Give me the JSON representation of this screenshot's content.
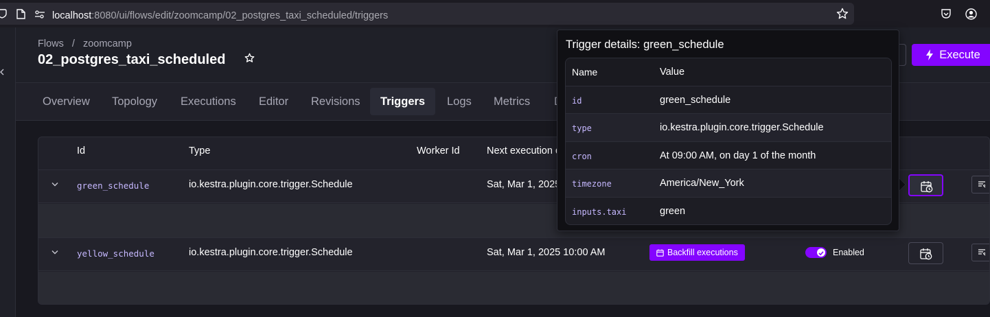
{
  "browser": {
    "url_host": "localhost",
    "url_rest": ":8080/ui/flows/edit/zoomcamp/02_postgres_taxi_scheduled/triggers"
  },
  "header": {
    "breadcrumb": [
      "Flows",
      "/",
      "zoomcamp"
    ],
    "title": "02_postgres_taxi_scheduled",
    "execute_label": "Execute"
  },
  "tabs": [
    {
      "label": "Overview"
    },
    {
      "label": "Topology"
    },
    {
      "label": "Executions"
    },
    {
      "label": "Editor"
    },
    {
      "label": "Revisions"
    },
    {
      "label": "Triggers",
      "active": true
    },
    {
      "label": "Logs"
    },
    {
      "label": "Metrics"
    },
    {
      "label": "D"
    }
  ],
  "table": {
    "headers": {
      "id": "Id",
      "type": "Type",
      "worker": "Worker Id",
      "next": "Next execution d"
    },
    "rows": [
      {
        "id": "green_schedule",
        "type": "io.kestra.plugin.core.trigger.Schedule",
        "next": "Sat, Mar 1, 2025"
      },
      {
        "id": "yellow_schedule",
        "type": "io.kestra.plugin.core.trigger.Schedule",
        "next": "Sat, Mar 1, 2025 10:00 AM",
        "backfill": "Backfill executions",
        "status": "Enabled"
      }
    ]
  },
  "popover": {
    "title": "Trigger details: green_schedule",
    "col_name": "Name",
    "col_value": "Value",
    "rows": [
      {
        "name": "id",
        "value": "green_schedule"
      },
      {
        "name": "type",
        "value": "io.kestra.plugin.core.trigger.Schedule"
      },
      {
        "name": "cron",
        "value": "At 09:00 AM, on day 1 of the month"
      },
      {
        "name": "timezone",
        "value": "America/New_York"
      },
      {
        "name": "inputs.taxi",
        "value": "green"
      }
    ]
  },
  "colors": {
    "accent": "#8405ff",
    "background": "#18181f",
    "mono_text": "#c6b8ff"
  }
}
